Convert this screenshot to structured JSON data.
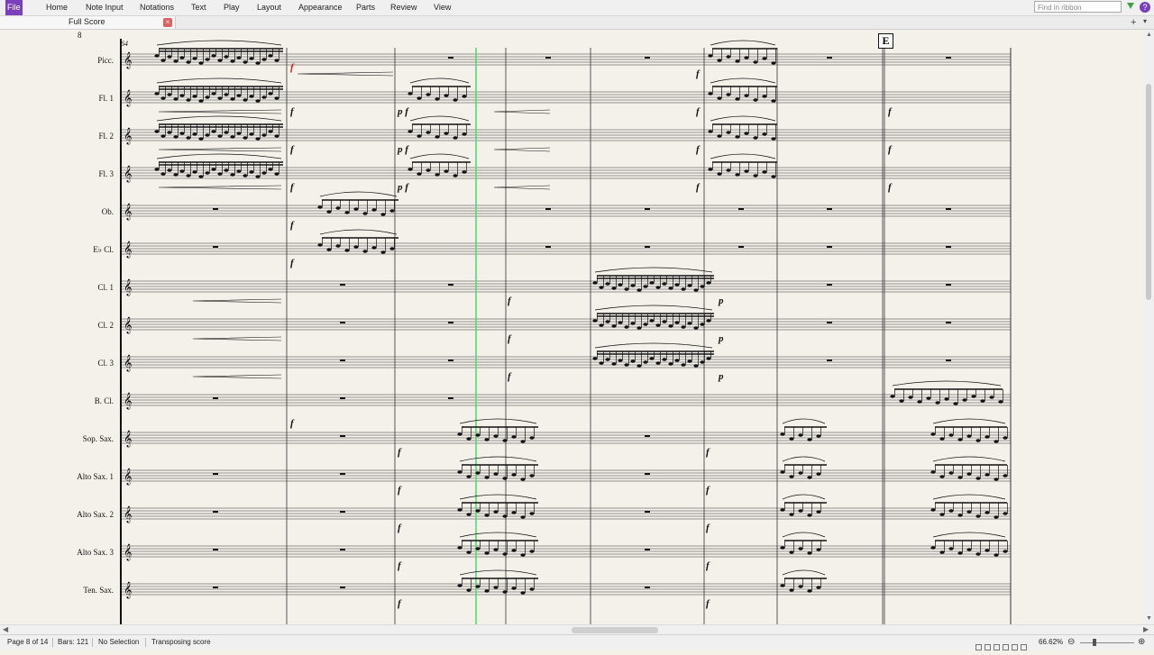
{
  "ribbon": {
    "tabs": [
      "File",
      "Home",
      "Note Input",
      "Notations",
      "Text",
      "Play",
      "Layout",
      "Appearance",
      "Parts",
      "Review",
      "View"
    ],
    "search_placeholder": "Find in ribbon",
    "help": "?"
  },
  "document_tab": {
    "label": "Full Score",
    "close": "×"
  },
  "tabbar_controls": {
    "new": "+",
    "menu": "▾"
  },
  "score": {
    "page_number": "8",
    "bar_number": "64",
    "rehearsal_mark": "E",
    "instruments": [
      "Picc.",
      "Fl. 1",
      "Fl. 2",
      "Fl. 3",
      "Ob.",
      "E♭ Cl.",
      "Cl. 1",
      "Cl. 2",
      "Cl. 3",
      "B. Cl.",
      "Sop. Sax.",
      "Alto Sax. 1",
      "Alto Sax. 2",
      "Alto Sax. 3",
      "Ten. Sax."
    ],
    "dynamics": {
      "forte": "f",
      "piano": "p",
      "piano_forte": "p f"
    }
  },
  "scroll": {
    "up": "▲",
    "down": "▼",
    "left": "◀",
    "right": "▶"
  },
  "status": {
    "page": "Page 8 of 14",
    "bars": "Bars: 121",
    "selection": "No Selection",
    "mode": "Transposing score",
    "zoom": "66.62%",
    "zoom_minus": "⊖",
    "zoom_plus": "⊕"
  },
  "colors": {
    "accent": "#7a3fbe",
    "playback_line": "#4cd964",
    "paper": "#f4f1ea"
  }
}
